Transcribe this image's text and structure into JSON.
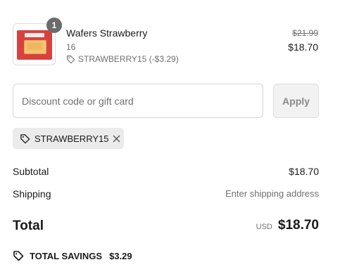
{
  "product": {
    "name": "Wafers Strawberry",
    "variant": "16",
    "quantity_badge": "1",
    "discount_line": "STRAWBERRY15 (-$3.29)",
    "original_price": "$21.99",
    "price": "$18.70",
    "image_icon": "product-thumbnail"
  },
  "discount": {
    "placeholder": "Discount code or gift card",
    "value": "",
    "apply_label": "Apply"
  },
  "applied_code": {
    "code": "STRAWBERRY15",
    "tag_icon": "tag-icon",
    "remove_icon": "close-icon"
  },
  "summary": {
    "subtotal_label": "Subtotal",
    "subtotal_value": "$18.70",
    "shipping_label": "Shipping",
    "shipping_value": "Enter shipping address",
    "total_label": "Total",
    "currency": "USD",
    "total_value": "$18.70",
    "savings_label": "TOTAL SAVINGS",
    "savings_value": "$3.29"
  },
  "colors": {
    "badge": "#6b6b6b",
    "muted_text": "#707070",
    "chip_bg": "#ebebeb",
    "apply_bg": "#f2f2f2"
  }
}
